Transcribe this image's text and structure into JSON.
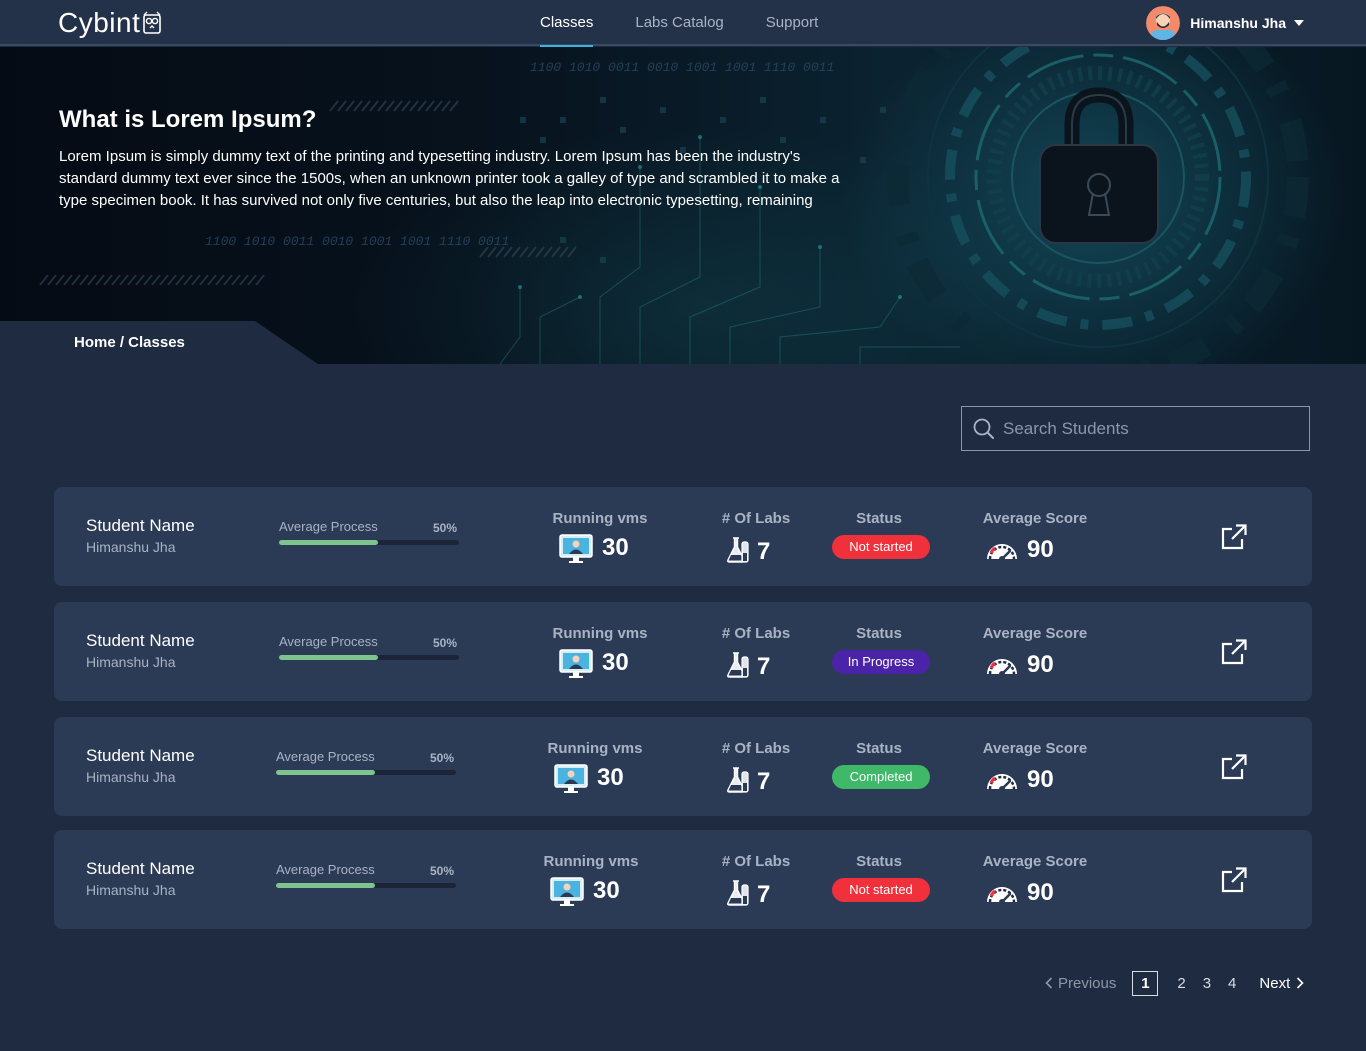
{
  "app": {
    "logo_text": "Cybint"
  },
  "nav": {
    "items": [
      {
        "label": "Classes",
        "active": true
      },
      {
        "label": "Labs Catalog",
        "active": false
      },
      {
        "label": "Support",
        "active": false
      }
    ]
  },
  "user": {
    "name": "Himanshu Jha"
  },
  "hero": {
    "title": "What is Lorem Ipsum?",
    "text": "Lorem Ipsum is simply dummy text of the printing and typesetting industry. Lorem Ipsum has been the industry's standard dummy text ever since the 1500s, when an unknown printer took a galley of type and scrambled it to make a type specimen book. It has survived not only five centuries, but also the leap into electronic typesetting, remaining",
    "binary_text_1": "1100 1010 0011 0010 1001 1001 1110 0011",
    "binary_text_2": "1100 1010 0011 0010 1001 1001 1110 0011"
  },
  "breadcrumb": {
    "text": "Home / Classes"
  },
  "search": {
    "placeholder": "Search Students"
  },
  "students": [
    {
      "name_label": "Student Name",
      "name": "Himanshu Jha",
      "progress_label": "Average Process",
      "progress_pct": "50%",
      "progress": 0.55,
      "vms_label": "Running vms",
      "vms": "30",
      "labs_label": "# Of Labs",
      "labs": "7",
      "status_label": "Status",
      "status": "Not started",
      "status_color": "#f0303b",
      "score_label": "Average Score",
      "score": "90"
    },
    {
      "name_label": "Student Name",
      "name": "Himanshu Jha",
      "progress_label": "Average Process",
      "progress_pct": "50%",
      "progress": 0.55,
      "vms_label": "Running vms",
      "vms": "30",
      "labs_label": "# Of Labs",
      "labs": "7",
      "status_label": "Status",
      "status": "In Progress",
      "status_color": "#4b23a8",
      "score_label": "Average Score",
      "score": "90"
    },
    {
      "name_label": "Student Name",
      "name": "Himanshu Jha",
      "progress_label": "Average Process",
      "progress_pct": "50%",
      "progress": 0.55,
      "vms_label": "Running vms",
      "vms": "30",
      "labs_label": "# Of Labs",
      "labs": "7",
      "status_label": "Status",
      "status": "Completed",
      "status_color": "#3fb86a",
      "score_label": "Average Score",
      "score": "90"
    },
    {
      "name_label": "Student Name",
      "name": "Himanshu Jha",
      "progress_label": "Average Process",
      "progress_pct": "50%",
      "progress": 0.55,
      "vms_label": "Running vms",
      "vms": "30",
      "labs_label": "# Of Labs",
      "labs": "7",
      "status_label": "Status",
      "status": "Not started",
      "status_color": "#f0303b",
      "score_label": "Average Score",
      "score": "90"
    }
  ],
  "pagination": {
    "previous_label": "Previous",
    "pages": [
      "1",
      "2",
      "3",
      "4"
    ],
    "current": "1",
    "next_label": "Next"
  },
  "colors": {
    "page_bg": "#1e2b40",
    "card_bg": "#2b3a55",
    "accent": "#38b6e0",
    "progress_fill": "#7fc48f"
  }
}
